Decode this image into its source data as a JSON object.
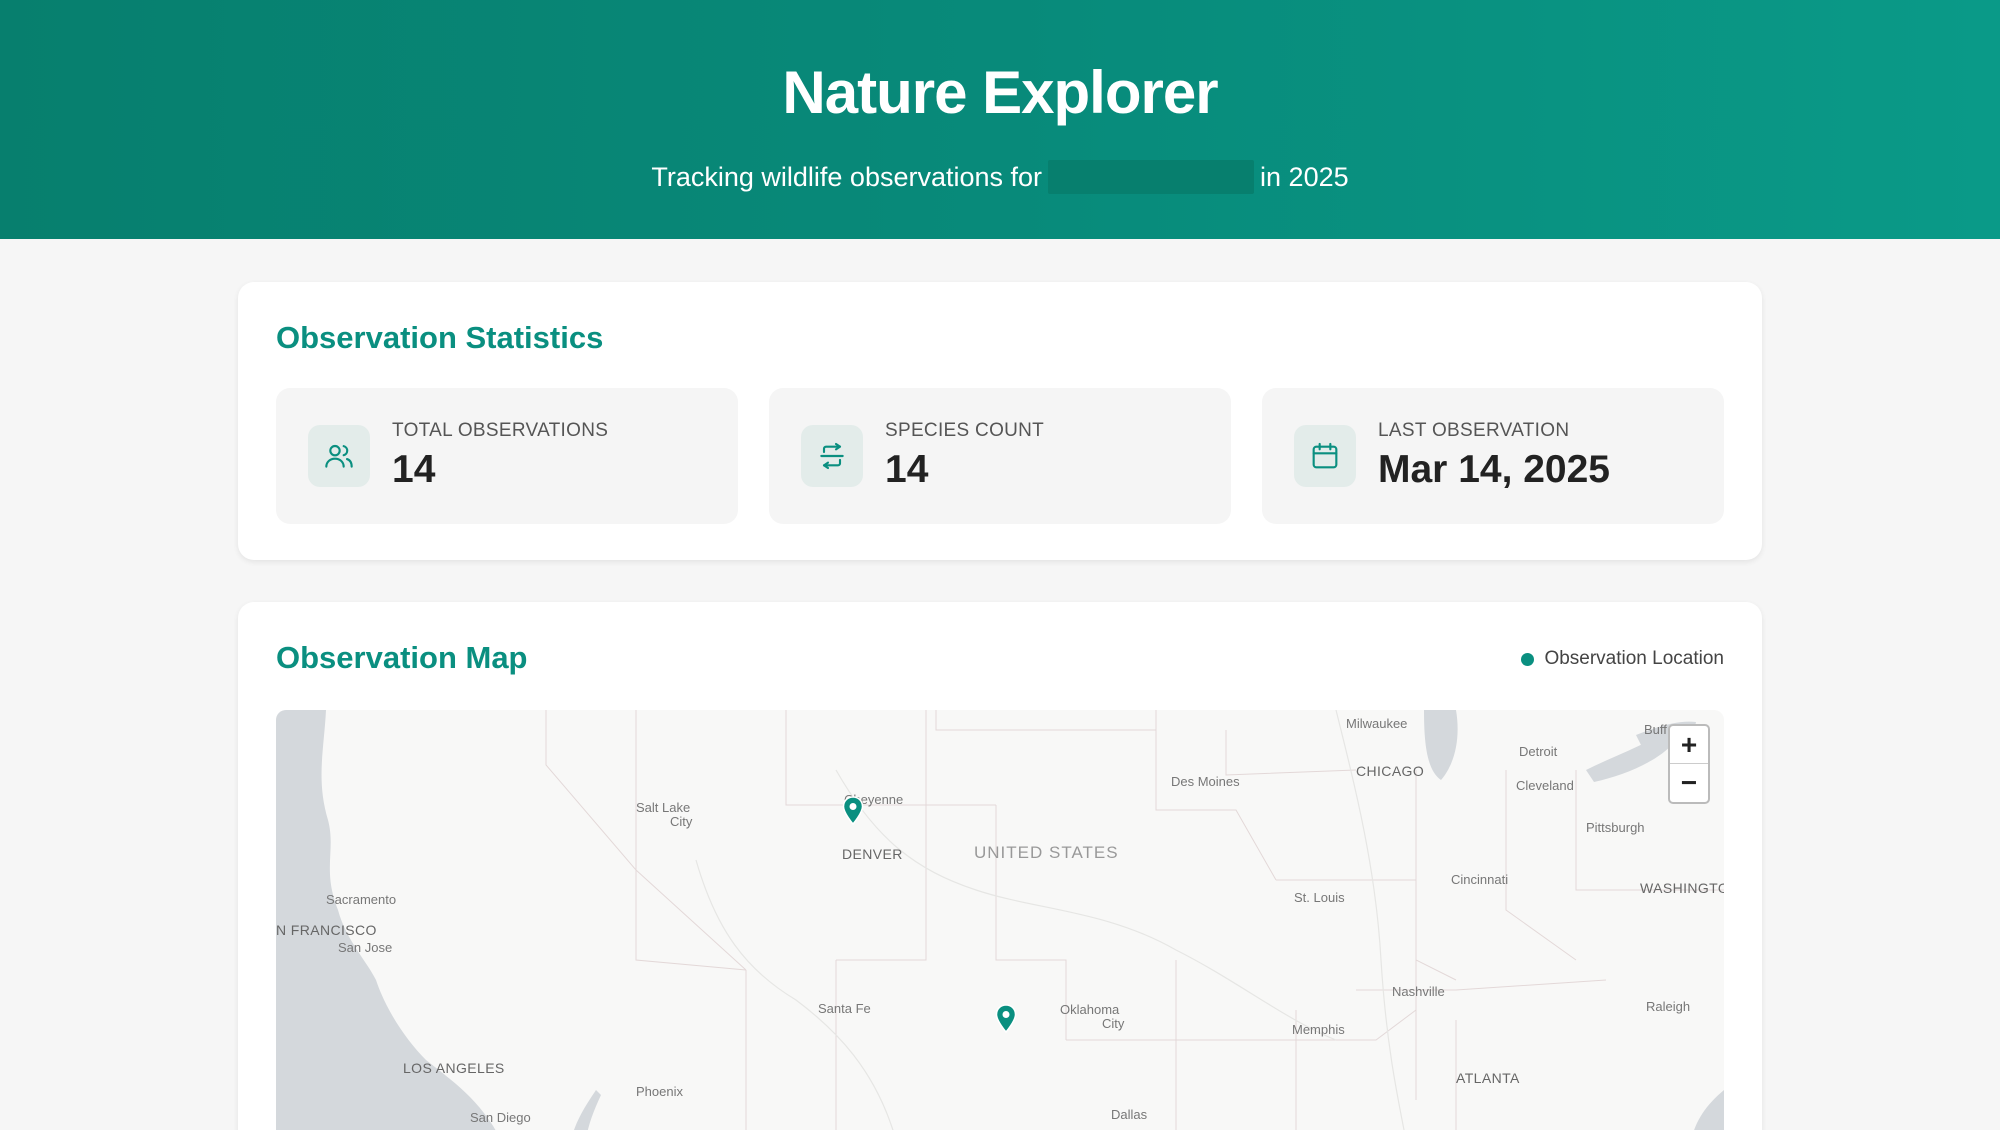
{
  "header": {
    "title": "Nature Explorer",
    "subtitle_before": "Tracking wildlife observations for",
    "subtitle_after": "in 2025"
  },
  "stats": {
    "title": "Observation Statistics",
    "items": [
      {
        "label": "TOTAL OBSERVATIONS",
        "value": "14",
        "icon": "users-icon"
      },
      {
        "label": "SPECIES COUNT",
        "value": "14",
        "icon": "species-icon"
      },
      {
        "label": "LAST OBSERVATION",
        "value": "Mar 14, 2025",
        "icon": "calendar-icon"
      }
    ]
  },
  "map": {
    "title": "Observation Map",
    "legend_label": "Observation Location",
    "zoom_in": "+",
    "zoom_out": "−",
    "country_label": "UNITED STATES",
    "cities": [
      "Milwaukee",
      "Detroit",
      "Buff",
      "CHICAGO",
      "Cleveland",
      "Des Moines",
      "Salt Lake",
      "City",
      "Cheyenne",
      "Pittsburgh",
      "DENVER",
      "Sacramento",
      "Cincinnati",
      "WASHINGTO",
      "St. Louis",
      "N FRANCISCO",
      "San Jose",
      "Nashville",
      "Santa Fe",
      "Oklahoma",
      "City",
      "Raleigh",
      "Memphis",
      "LOS ANGELES",
      "ATLANTA",
      "Phoenix",
      "San Diego",
      "Dallas"
    ]
  },
  "colors": {
    "accent": "#0a8f80",
    "header_start": "#077f6e",
    "header_end": "#0a9a88"
  }
}
